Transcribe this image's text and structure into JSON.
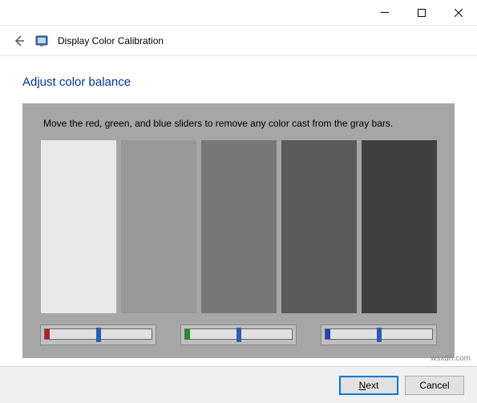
{
  "window": {
    "title": "Display Color Calibration"
  },
  "heading": "Adjust color balance",
  "instruction": "Move the red, green, and blue sliders to remove any color cast from the gray bars.",
  "bars": [
    {
      "color": "#e8e8e8"
    },
    {
      "color": "#989898"
    },
    {
      "color": "#787878"
    },
    {
      "color": "#5a5a5a"
    },
    {
      "color": "#404040"
    }
  ],
  "sliders": {
    "red": {
      "accent": "#b02020",
      "value": 50
    },
    "green": {
      "accent": "#209020",
      "value": 50
    },
    "blue": {
      "accent": "#2040c0",
      "value": 50
    }
  },
  "buttons": {
    "next": "Next",
    "cancel": "Cancel"
  },
  "watermark": "wsxdn.com"
}
